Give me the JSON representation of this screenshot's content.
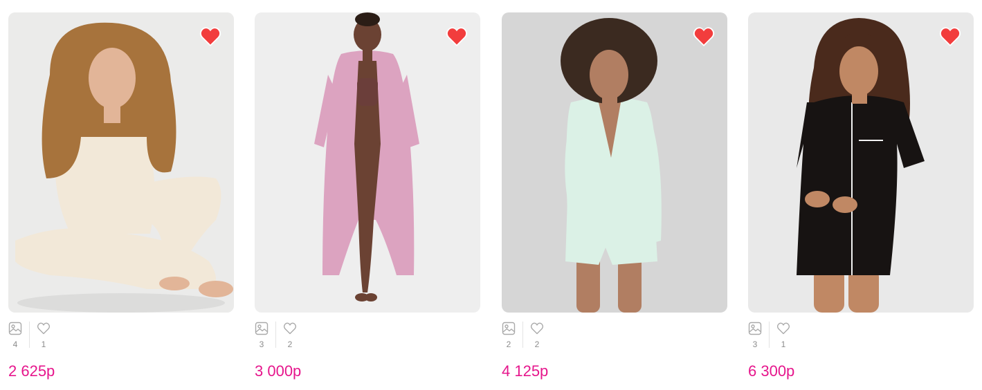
{
  "accent_color": "#e6168c",
  "heart_color": "#f23d3d",
  "products": [
    {
      "price": "2 625р",
      "photos_count": "4",
      "likes_count": "1",
      "image": "woman-in-cream-ribbed-lounge-set",
      "background": "#ebebea",
      "garment_color": "#f2e8d8",
      "hair_color": "#a7733c",
      "skin_color": "#e2b598"
    },
    {
      "price": "3 000р",
      "photos_count": "3",
      "likes_count": "2",
      "image": "woman-in-pink-lace-robe",
      "background": "#eeeeee",
      "garment_color": "#dca3c0",
      "hair_color": "#2b1d16",
      "skin_color": "#6b4233"
    },
    {
      "price": "4 125р",
      "photos_count": "2",
      "likes_count": "2",
      "image": "woman-in-mint-satin-pajamas",
      "background": "#d6d6d6",
      "garment_color": "#dbf1e6",
      "hair_color": "#3b2a20",
      "skin_color": "#b17e62"
    },
    {
      "price": "6 300р",
      "photos_count": "3",
      "likes_count": "1",
      "image": "woman-in-black-short-pajamas",
      "background": "#e9e9e9",
      "garment_color": "#171312",
      "hair_color": "#4a2a1c",
      "skin_color": "#c08864"
    }
  ]
}
